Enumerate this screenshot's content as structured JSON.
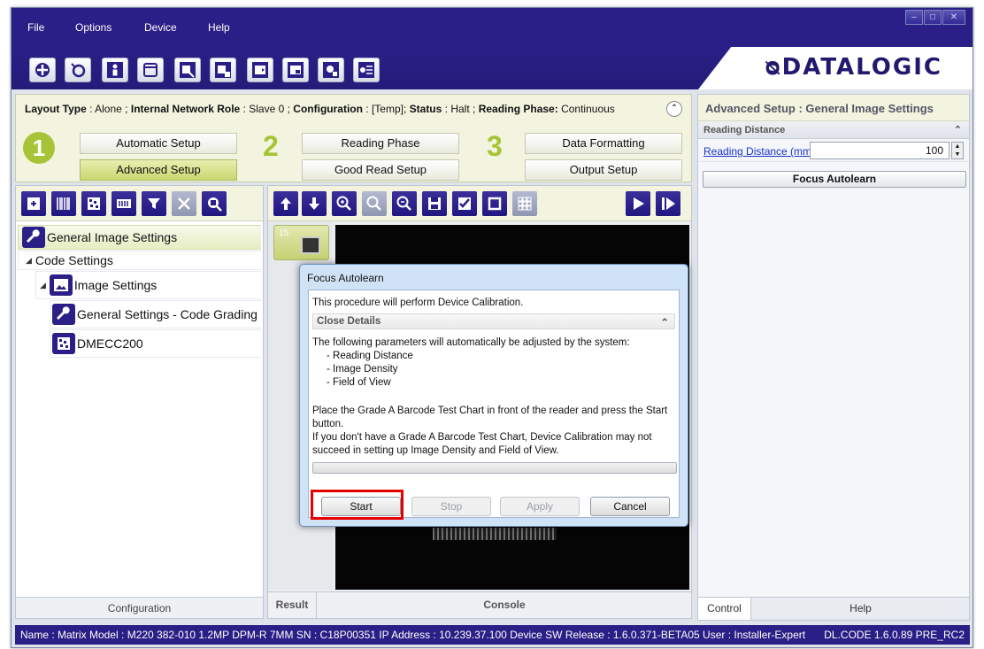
{
  "menu": {
    "items": [
      "File",
      "Options",
      "Device",
      "Help"
    ]
  },
  "window_controls": [
    "minimize-icon",
    "maximize-icon",
    "close-icon"
  ],
  "toolbar": {
    "icons": [
      "getting-started-icon",
      "device-discovery-icon",
      "user-icon",
      "window-icon",
      "open-config-icon",
      "save-config-icon",
      "export-icon",
      "import-icon",
      "settings-icon",
      "transfer-icon"
    ]
  },
  "brand": {
    "logo": "ᴓDATALOGIC"
  },
  "setup": {
    "layout_type_label": "Layout Type",
    "layout_type_value": "Alone",
    "network_role_label": "Internal Network Role",
    "network_role_value": "Slave 0",
    "configuration_label": "Configuration",
    "configuration_value": "[Temp]",
    "status_label": "Status",
    "status_value": "Halt",
    "reading_phase_label": "Reading Phase:",
    "reading_phase_value": "Continuous",
    "step1": "1",
    "step2": "2",
    "step3": "3",
    "automatic_setup": "Automatic Setup",
    "advanced_setup": "Advanced Setup",
    "reading_phase": "Reading Phase",
    "good_read_setup": "Good Read Setup",
    "data_formatting": "Data Formatting",
    "output_setup": "Output Setup"
  },
  "right_panel": {
    "title": "Advanced Setup :  General Image Settings",
    "section": "Reading Distance",
    "reading_distance_label": "Reading Distance (mm)",
    "reading_distance_value": "100",
    "focus_autolearn_button": "Focus Autolearn",
    "tabs": [
      "Control",
      "Help"
    ]
  },
  "config_panel": {
    "tree": {
      "root": "General Image Settings",
      "code_settings": "Code Settings",
      "image_settings": "Image Settings",
      "general_settings_code_grading": "General Settings - Code Grading",
      "dmecc200": "DMECC200"
    },
    "footer": "Configuration"
  },
  "image_panel": {
    "thumb_number": "15",
    "footer_tabs": [
      "Result",
      "Console"
    ]
  },
  "status_bar": {
    "text": "Name : Matrix  Model : M220 382-010 1.2MP DPM-R 7MM   SN : C18P00351   IP Address :  10.239.37.100   Device SW Release : 1.6.0.371-BETA05   User : Installer-Expert",
    "version": "DL.CODE 1.6.0.89 PRE_RC2"
  },
  "dialog": {
    "title": "Focus Autolearn",
    "line1": "This procedure will perform Device Calibration.",
    "details_header": "Close Details",
    "intro": "The following parameters will automatically be adjusted by the system:",
    "params": [
      "- Reading Distance",
      "- Image Density",
      "- Field of View"
    ],
    "para2_line1": "Place the Grade A Barcode Test Chart in front of the reader and press the Start",
    "para2_line2": "button.",
    "para2_line3": "If you don't have a Grade A Barcode Test Chart, Device Calibration may not",
    "para2_line4": "succeed in setting up Image Density and Field of View.",
    "buttons": {
      "start": "Start",
      "stop": "Stop",
      "apply": "Apply",
      "cancel": "Cancel"
    }
  }
}
